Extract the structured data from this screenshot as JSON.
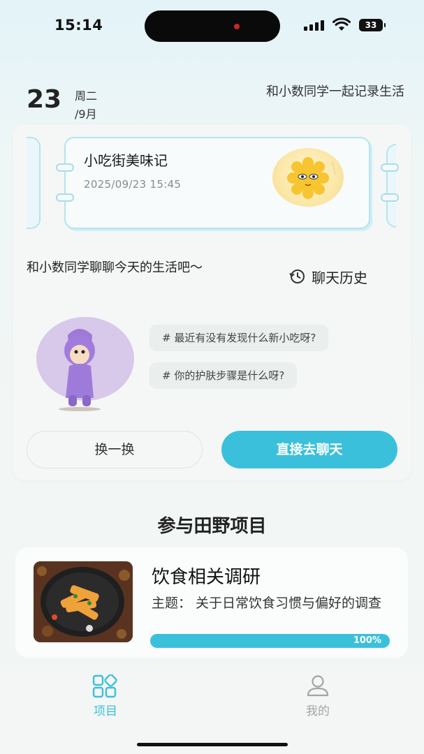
{
  "status_bar": {
    "time": "15:14",
    "battery": "33"
  },
  "header": {
    "day": "23",
    "weekday": "周二",
    "month": "/9月",
    "tagline": "和小数同学一起记录生活"
  },
  "diary": {
    "title": "小吃街美味记",
    "timestamp": "2025/09/23 15:45"
  },
  "chat": {
    "prompt": "和小数同学聊聊今天的生活吧～",
    "history_label": "聊天历史",
    "topics": [
      "# 最近有没有发现什么新小吃呀?",
      "# 你的护肤步骤是什么呀?"
    ],
    "shuffle_label": "换一换",
    "start_label": "直接去聊天"
  },
  "projects": {
    "section_title": "参与田野项目",
    "items": [
      {
        "title": "饮食相关调研",
        "description": "主题：  关于日常饮食习惯与偏好的调查",
        "progress": 1.0,
        "progress_text": "100%"
      }
    ]
  },
  "tabs": [
    {
      "label": "项目",
      "icon": "grid-icon",
      "active": true
    },
    {
      "label": "我的",
      "icon": "user-icon",
      "active": false
    }
  ],
  "colors": {
    "accent": "#3bc0dc",
    "inactive": "#a4a4a4"
  }
}
